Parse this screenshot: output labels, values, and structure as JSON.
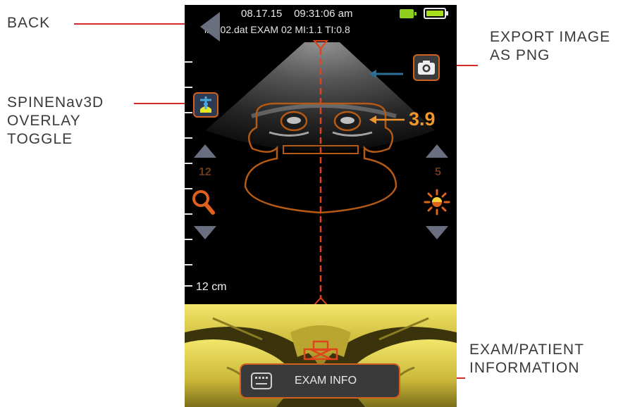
{
  "annotations": {
    "back": [
      "BACK"
    ],
    "spine_overlay": [
      "SPINENav3D",
      "OVERLAY",
      "TOGGLE"
    ],
    "export": [
      "EXPORT IMAGE",
      "AS PNG"
    ],
    "exam": [
      "EXAM/PATIENT",
      "INFORMATION"
    ]
  },
  "status": {
    "date": "08.17.15",
    "time": "09:31:06 am",
    "file_info": "img02.dat  EXAM 02  MI:1.1  TI:0.8"
  },
  "controls": {
    "zoom_level": "12",
    "brightness_level": "5",
    "depth_label": "12 cm",
    "measurement": "3.9",
    "exam_info_label": "EXAM INFO"
  },
  "icons": {
    "back": "back-triangle-icon",
    "overlay": "spine-overlay-icon",
    "export": "camera-icon",
    "zoom": "magnifier-icon",
    "brightness": "sun-icon",
    "exam": "keyboard-icon"
  },
  "colors": {
    "accent": "#d2601e",
    "annotation_line": "#d62a2a",
    "measurement": "#f0962a",
    "battery": "#a7e01e"
  }
}
